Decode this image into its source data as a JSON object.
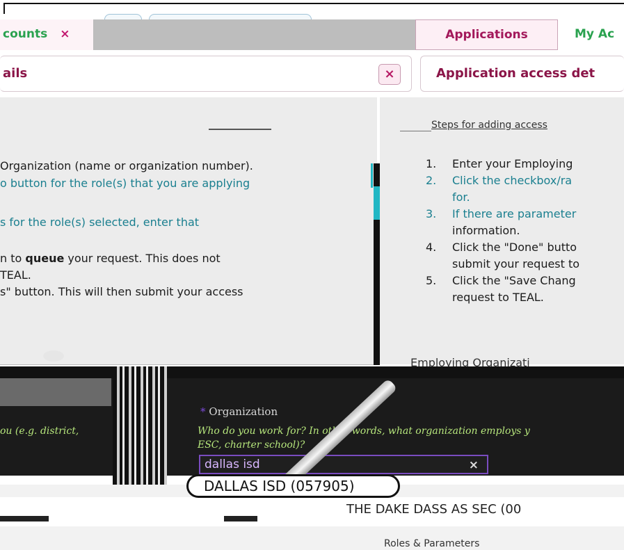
{
  "tabs": {
    "left_label": "counts",
    "left_close": "×",
    "applications": "Applications",
    "my_accounts": "My Ac"
  },
  "panel_left": {
    "title": "ails",
    "close": "×",
    "lines": [
      "Organization (name or organization number).",
      "o button for the role(s) that you are applying",
      "s for the role(s) selected, enter that",
      "n to queue your request. This does not",
      " TEAL.",
      "s\" button. This will then submit your access"
    ],
    "queue_word": "queue"
  },
  "panel_right": {
    "title": "Application access det",
    "section_title": "Steps for adding access",
    "steps": [
      {
        "num": "1.",
        "text": "Enter your Employing"
      },
      {
        "num": "2.",
        "text": "Click the checkbox/ra"
      },
      {
        "num": "",
        "text": "for."
      },
      {
        "num": "3.",
        "text": "If there are parameter"
      },
      {
        "num": "",
        "text": "information."
      },
      {
        "num": "4.",
        "text": "Click the \"Done\" butto"
      },
      {
        "num": "",
        "text": "submit your request to"
      },
      {
        "num": "5.",
        "text": "Click the \"Save Chang"
      },
      {
        "num": "",
        "text": "request to TEAL."
      }
    ],
    "employing_label": "Employing Organizati"
  },
  "form": {
    "left_hint": "ou (e.g. district,",
    "org_label": "Organization",
    "org_required": "*",
    "org_help_1": "Who do you work for? In other words, what organization employs y",
    "org_help_2": "ESC, charter school)?",
    "org_value": "dallas isd",
    "org_clear": "×",
    "suggestion": "DALLAS ISD (057905)",
    "bottom_title": "THE DAKE DASS AS SEC (00 ",
    "roles_label": "Roles & Parameters"
  }
}
